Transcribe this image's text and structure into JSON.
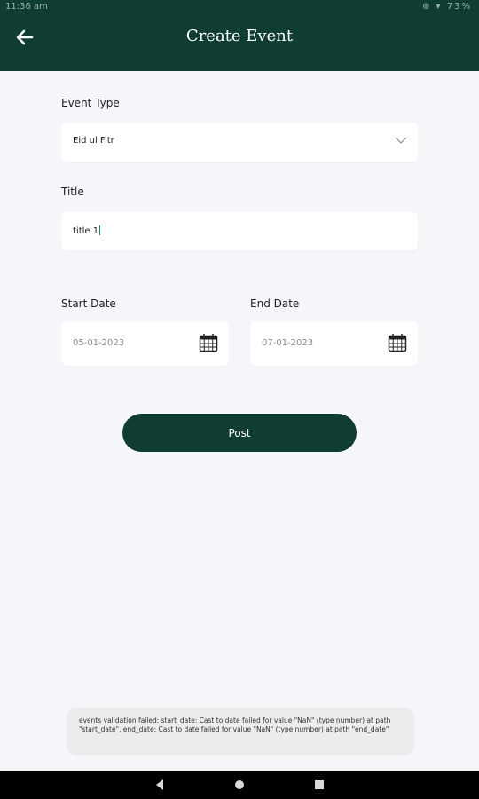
{
  "status_bar": {
    "time": "11:36 am",
    "battery": "73%"
  },
  "app_bar": {
    "title": "Create Event"
  },
  "form": {
    "event_type": {
      "label": "Event Type",
      "value": "Eid ul Fitr"
    },
    "title": {
      "label": "Title",
      "value": "title 1"
    },
    "start_date": {
      "label": "Start Date",
      "value": "05-01-2023"
    },
    "end_date": {
      "label": "End Date",
      "value": "07-01-2023"
    }
  },
  "post_button": {
    "label": "Post"
  },
  "toast": {
    "message": "events validation failed: start_date: Cast to date failed for value \"NaN\" (type number) at path \"start_date\", end_date: Cast to date failed for value \"NaN\" (type number) at path \"end_date\""
  },
  "colors": {
    "primary": "#0f3d34",
    "background": "#f5f6fa",
    "field": "#ffffff"
  },
  "icons": [
    "back-arrow-icon",
    "chevron-down-icon",
    "calendar-icon",
    "nav-back-icon",
    "nav-home-icon",
    "nav-recents-icon"
  ]
}
